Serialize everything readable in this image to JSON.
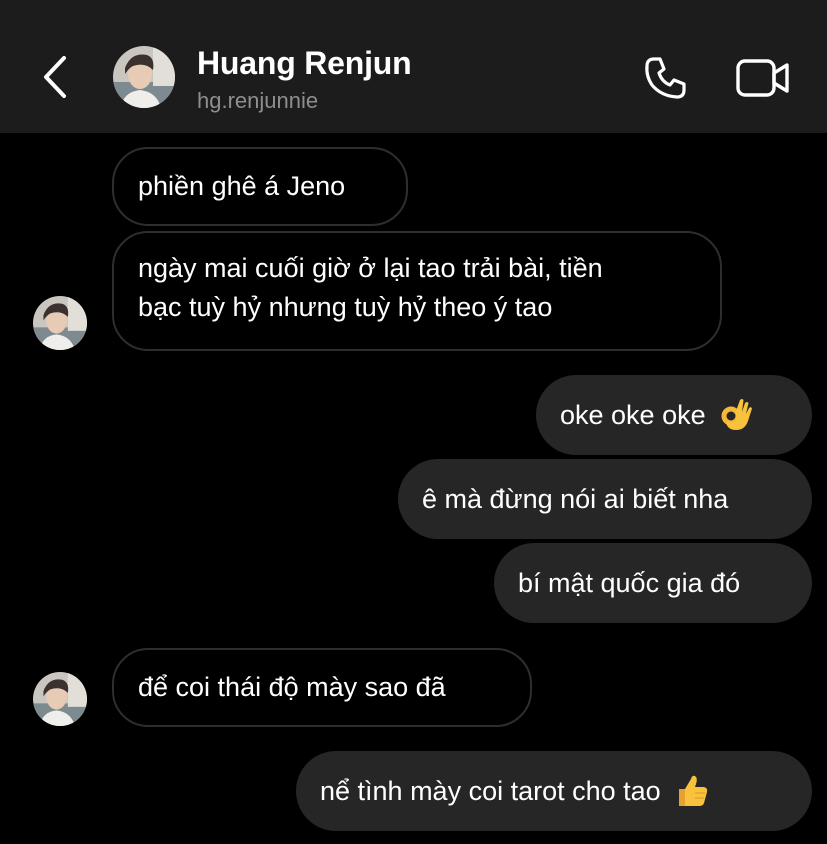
{
  "contact": {
    "name": "Huang Renjun",
    "handle": "hg.renjunnie"
  },
  "icons": {
    "back": "chevron-left-icon",
    "call": "phone-icon",
    "video": "video-camera-icon",
    "ok_hand": "ok-hand-emoji",
    "thumbs_up": "thumbs-up-emoji"
  },
  "messages": [
    {
      "sender": "them",
      "text": "phiền ghê á Jeno"
    },
    {
      "sender": "them",
      "lines": [
        "ngày mai cuối giờ ở lại tao trải bài, tiền",
        "bạc tuỳ hỷ nhưng tuỳ hỷ theo ý tao"
      ]
    },
    {
      "sender": "me",
      "text": "oke oke oke",
      "emoji": "ok-hand-emoji"
    },
    {
      "sender": "me",
      "text": "ê mà đừng nói ai biết nha"
    },
    {
      "sender": "me",
      "text": "bí mật quốc gia đó"
    },
    {
      "sender": "them",
      "text": "để coi thái độ mày sao đã"
    },
    {
      "sender": "me",
      "text": "nể tình mày coi tarot cho tao",
      "emoji": "thumbs-up-emoji"
    }
  ],
  "colors": {
    "background": "#000000",
    "header": "#1c1c1c",
    "outgoing_bubble": "#262626",
    "incoming_border": "#2e2e2e",
    "handle_text": "#8e8e8e"
  }
}
